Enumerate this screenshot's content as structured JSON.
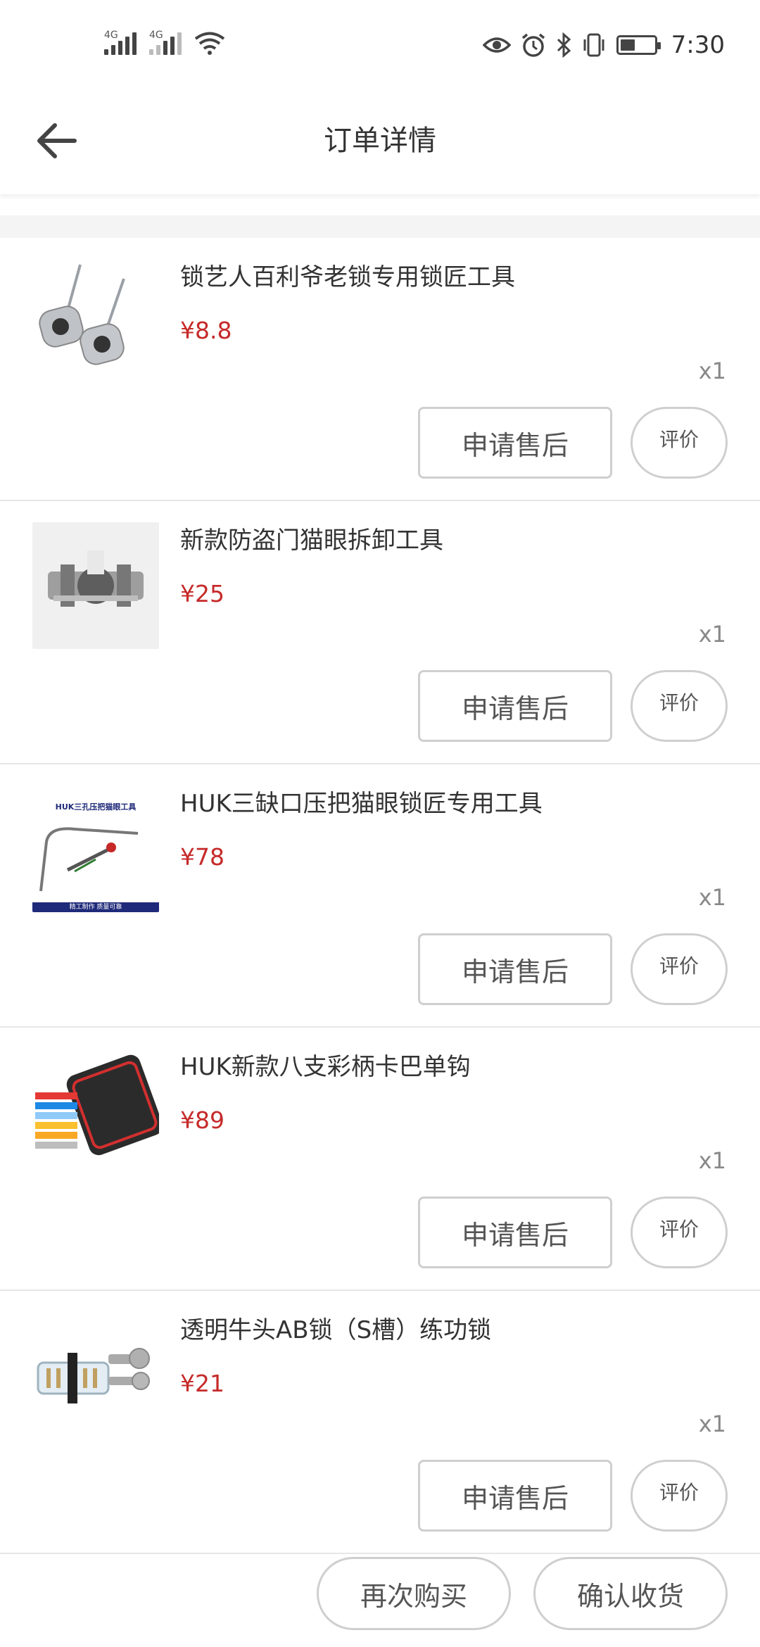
{
  "status_bar": {
    "sim1_label": "4G",
    "sim2_label": "4G",
    "time": "7:30",
    "icons": [
      "signal-icon",
      "wifi-icon",
      "eye-icon",
      "alarm-icon",
      "bluetooth-icon",
      "vibrate-icon",
      "battery-icon"
    ],
    "battery_level": 0.45
  },
  "header": {
    "title": "订单详情",
    "back_icon": "arrow-left-icon"
  },
  "items": [
    {
      "name": "锁艺人百利爷老锁专用锁匠工具",
      "price": "¥8.8",
      "qty": "x1",
      "after_sale_label": "申请售后",
      "rate_label": "评价"
    },
    {
      "name": "新款防盗门猫眼拆卸工具",
      "price": "¥25",
      "qty": "x1",
      "after_sale_label": "申请售后",
      "rate_label": "评价"
    },
    {
      "name": "HUK三缺口压把猫眼锁匠专用工具",
      "price": "¥78",
      "qty": "x1",
      "after_sale_label": "申请售后",
      "rate_label": "评价"
    },
    {
      "name": "HUK新款八支彩柄卡巴单钩",
      "price": "¥89",
      "qty": "x1",
      "after_sale_label": "申请售后",
      "rate_label": "评价"
    },
    {
      "name": "透明牛头AB锁（S槽）练功锁",
      "price": "¥21",
      "qty": "x1",
      "after_sale_label": "申请售后",
      "rate_label": "评价"
    }
  ],
  "thumbnail_texts": {
    "item3_banner_top": "HUK三孔压把猫眼工具",
    "item3_banner_bottom": "精工制作 质量可靠"
  },
  "actions": {
    "buy_again_label": "再次购买",
    "confirm_receipt_label": "确认收货"
  },
  "colors": {
    "price": "#c62a2a",
    "border": "#cfcfcf",
    "divider": "#e6e6e6"
  }
}
